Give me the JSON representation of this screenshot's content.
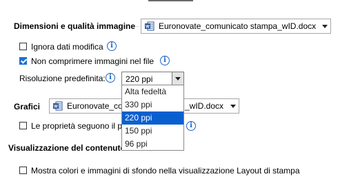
{
  "section_image": {
    "title": "Dimensioni e qualità immagine",
    "document": "Euronovate_comunicato stampa_wID.docx"
  },
  "options": {
    "ignore_edit_data": {
      "label": "Ignora dati modifica",
      "checked": false
    },
    "no_compress": {
      "label": "Non comprimere immagini nel file",
      "checked": true
    },
    "default_resolution": {
      "label": "Risoluzione predefinita:",
      "value": "220 ppi"
    }
  },
  "resolution_dropdown": {
    "options": [
      "Alta fedeltà",
      "330 ppi",
      "220 ppi",
      "150 ppi",
      "96 ppi"
    ],
    "selected_index": 2
  },
  "section_charts": {
    "title": "Grafici",
    "document": "Euronovate_co",
    "document_tail": "_wID.docx",
    "follow_properties_label": "Le proprietà seguono il p"
  },
  "section_display": {
    "title": "Visualizzazione del contenuto",
    "show_colors_label": "Mostra colori e immagini di sfondo nella visualizzazione Layout di stampa"
  },
  "icons": {
    "info": "i",
    "accent": "#1a64c8",
    "selection": "#0a5fcf",
    "word_blue": "#2b579a"
  }
}
